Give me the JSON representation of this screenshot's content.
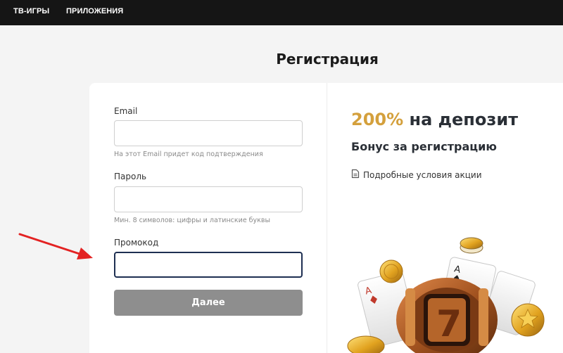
{
  "nav": {
    "items": [
      {
        "label": "ТВ-ИГРЫ"
      },
      {
        "label": "ПРИЛОЖЕНИЯ"
      }
    ]
  },
  "page": {
    "title": "Регистрация"
  },
  "form": {
    "email": {
      "label": "Email",
      "value": "",
      "hint": "На этот Email придет код подтверждения"
    },
    "password": {
      "label": "Пароль",
      "value": "",
      "hint": "Мин. 8 символов: цифры и латинские буквы"
    },
    "promo": {
      "label": "Промокод",
      "value": ""
    },
    "submit_label": "Далее"
  },
  "bonus": {
    "percent": "200%",
    "headline_rest": " на депозит",
    "subtitle": "Бонус за регистрацию",
    "terms_link": "Подробные условия акции"
  },
  "colors": {
    "topbar": "#151515",
    "bonus_accent": "#d4a03c",
    "submit_button": "#8e8e8e",
    "active_input_border": "#1e2f52",
    "annotation_arrow": "#e32222"
  }
}
